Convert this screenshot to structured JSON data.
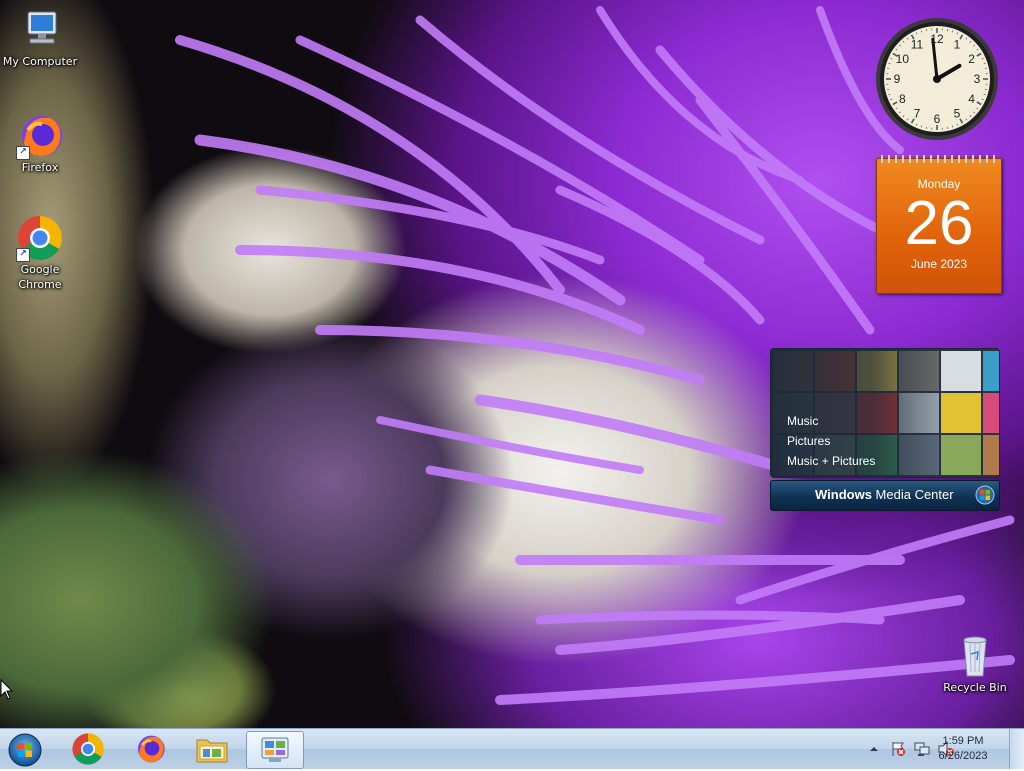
{
  "desktop_icons": [
    {
      "name": "my-computer",
      "label": "My Computer"
    },
    {
      "name": "firefox",
      "label": "Firefox"
    },
    {
      "name": "google-chrome",
      "label": "Google Chrome"
    },
    {
      "name": "recycle-bin",
      "label": "Recycle Bin"
    }
  ],
  "clock_gadget": {
    "hour": 1,
    "minute": 59,
    "numbers": [
      "12",
      "1",
      "2",
      "3",
      "4",
      "5",
      "6",
      "7",
      "8",
      "9",
      "10",
      "11"
    ]
  },
  "calendar_gadget": {
    "day_name": "Monday",
    "day_number": "26",
    "month_year": "June 2023"
  },
  "media_center_gadget": {
    "menu": [
      "Music",
      "Pictures",
      "Music + Pictures"
    ],
    "title_bold": "Windows",
    "title_rest": " Media Center"
  },
  "taskbar": {
    "pinned": [
      "start-orb",
      "chrome-icon",
      "firefox-icon",
      "file-explorer-icon",
      "control-panel-icon"
    ],
    "tray_icons": [
      "show-hidden-icons-arrow",
      "action-center-icon",
      "network-icon",
      "volume-muted-icon"
    ],
    "time": "1:59 PM",
    "date": "6/26/2023"
  },
  "colors": {
    "taskbar_top": "#d9e6f3",
    "calendar_orange": "#e0620a",
    "wmc_bar": "#0f3254"
  }
}
